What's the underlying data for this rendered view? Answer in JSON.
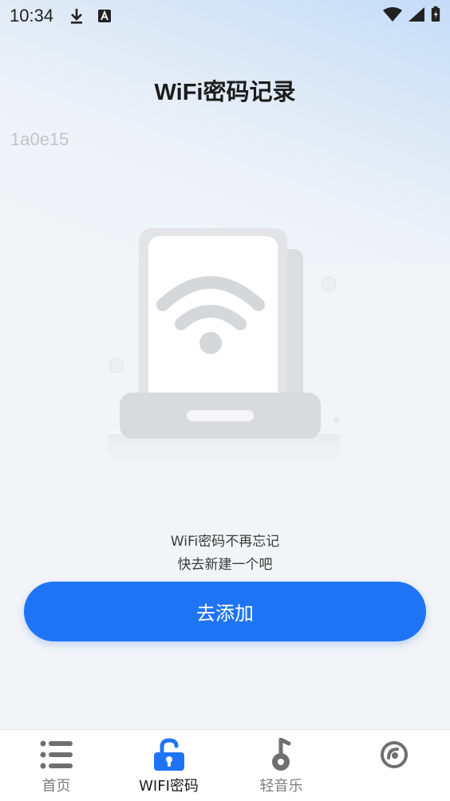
{
  "status_bar": {
    "time": "10:34",
    "icons": [
      "download-icon",
      "font-badge-icon",
      "wifi-icon",
      "signal-icon",
      "battery-icon"
    ]
  },
  "header": {
    "title": "WiFi密码记录"
  },
  "overlay": {
    "code": "1a0e15"
  },
  "empty_state": {
    "illustration": "wifi-router-illustration",
    "line1": "WiFi密码不再忘记",
    "line2": "快去新建一个吧"
  },
  "actions": {
    "add_label": "去添加"
  },
  "colors": {
    "accent": "#1f74f6",
    "active_icon": "#1f74f6",
    "inactive_icon": "#6f6f6f"
  },
  "bottom_nav": {
    "items": [
      {
        "label": "首页",
        "icon": "list-icon",
        "active": false
      },
      {
        "label": "WIFI密码",
        "icon": "unlock-icon",
        "active": true
      },
      {
        "label": "轻音乐",
        "icon": "music-note-icon",
        "active": false
      },
      {
        "label": "",
        "icon": "disc-icon",
        "active": false
      }
    ]
  }
}
